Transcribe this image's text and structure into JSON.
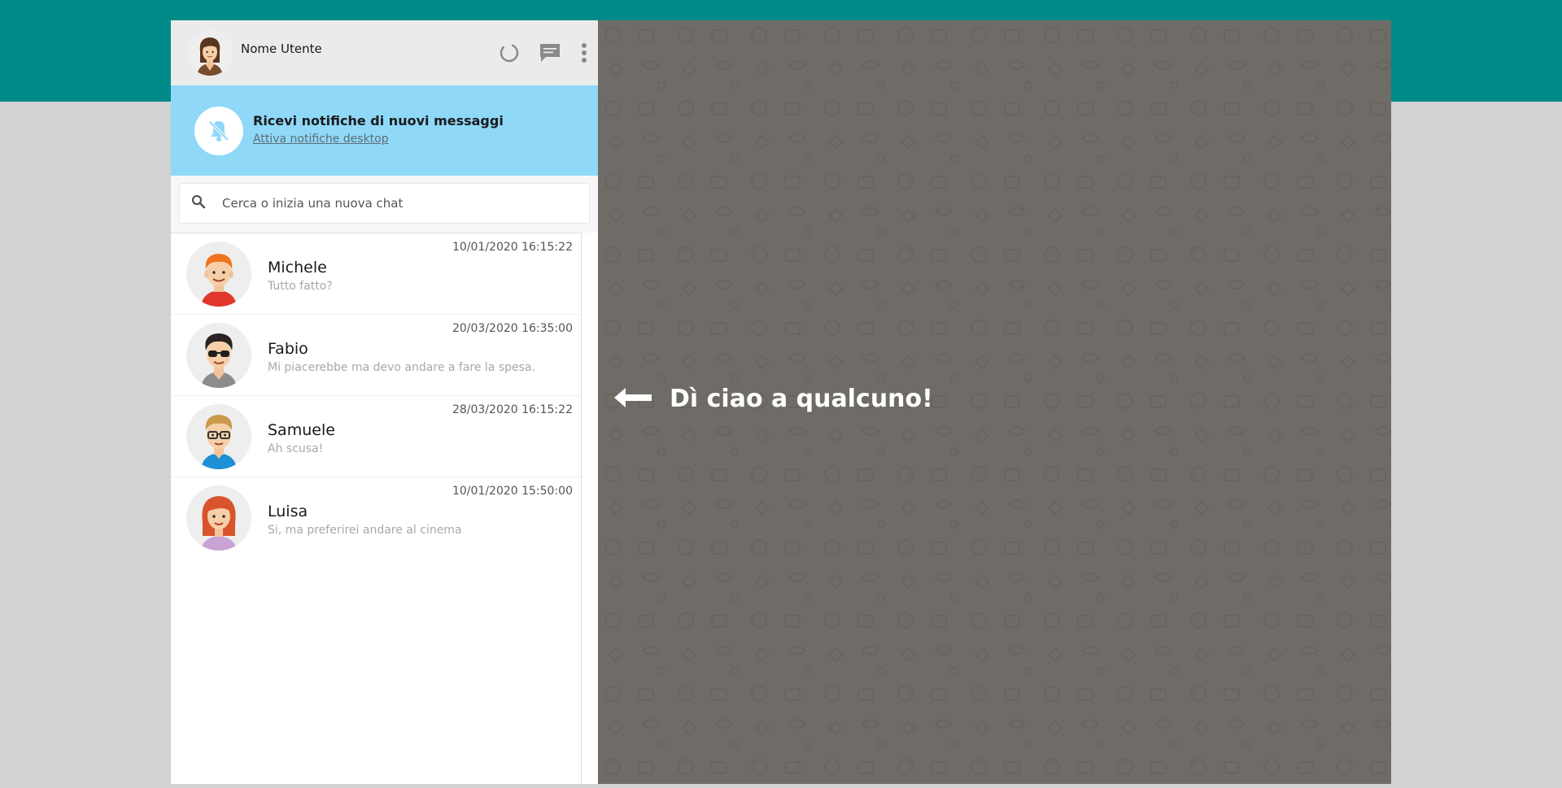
{
  "header": {
    "user_name": "Nome Utente",
    "icons": [
      "status-icon",
      "new-chat-icon",
      "menu-icon"
    ]
  },
  "notification": {
    "title": "Ricevi notifiche di nuovi messaggi",
    "link": "Attiva notifiche desktop",
    "icon": "bell-off-icon"
  },
  "search": {
    "placeholder": "Cerca o inizia una nuova chat",
    "icon": "search-icon"
  },
  "chats": [
    {
      "name": "Michele",
      "preview": "Tutto fatto?",
      "time": "10/01/2020 16:15:22"
    },
    {
      "name": "Fabio",
      "preview": "Mi piacerebbe ma devo andare a fare la spesa.",
      "time": "20/03/2020 16:35:00"
    },
    {
      "name": "Samuele",
      "preview": "Ah scusa!",
      "time": "28/03/2020 16:15:22"
    },
    {
      "name": "Luisa",
      "preview": "Si, ma preferirei andare al cinema",
      "time": "10/01/2020 15:50:00"
    }
  ],
  "main": {
    "hello_text": "Dì ciao a qualcuno!",
    "icon": "arrow-left-icon"
  },
  "colors": {
    "top_band": "#008b89",
    "banner": "#8fd8f8",
    "main_bg": "#6f6b66",
    "page_bg": "#d2d2d2"
  }
}
